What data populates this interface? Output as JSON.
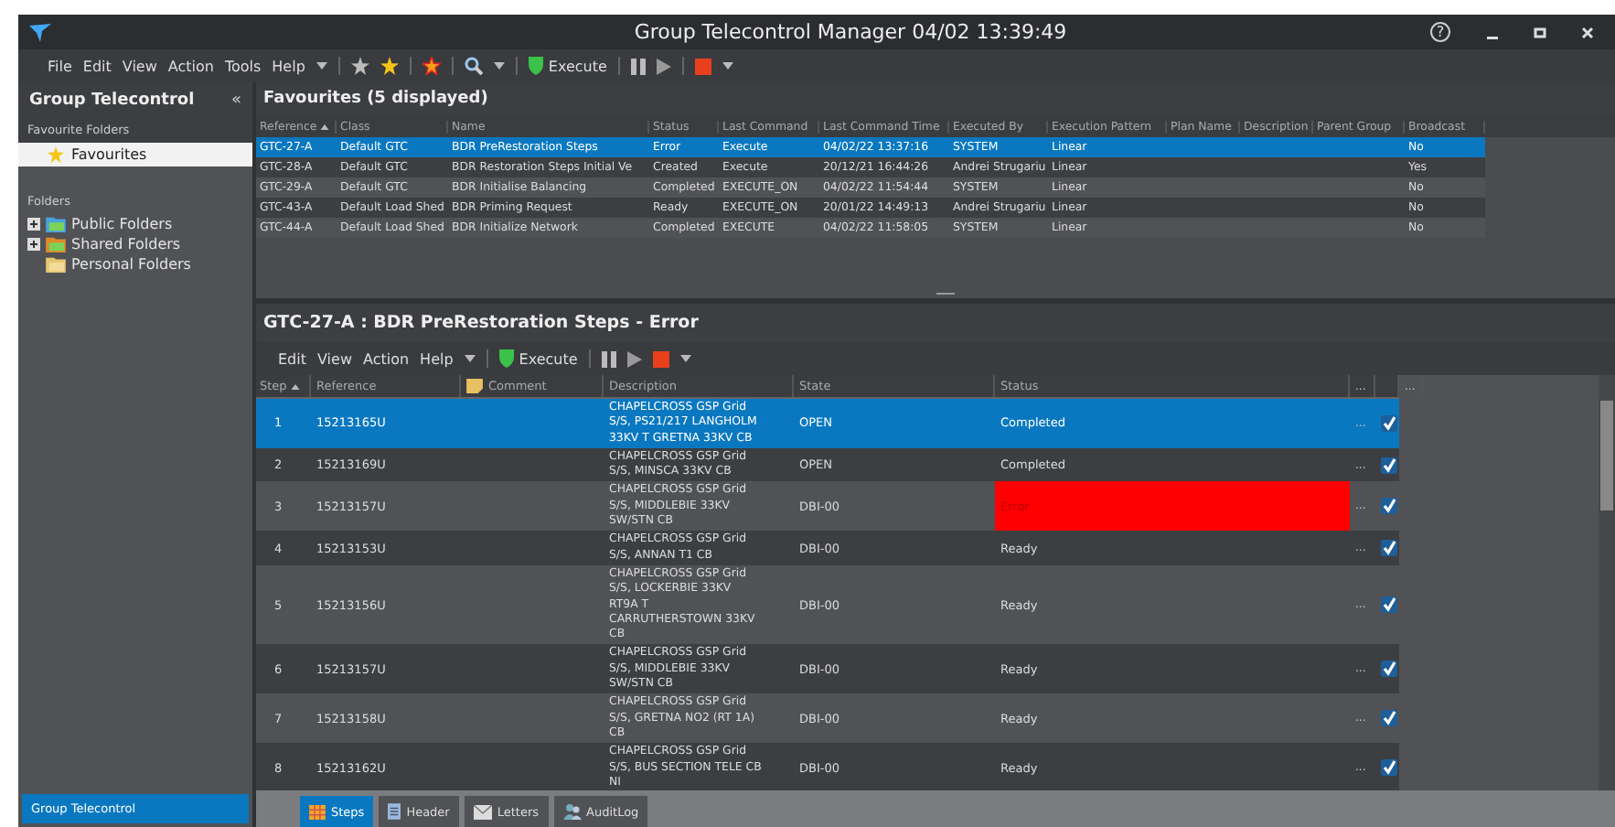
{
  "window": {
    "title": "Group Telecontrol Manager 04/02 13:39:49",
    "help": "?"
  },
  "menu": [
    "File",
    "Edit",
    "View",
    "Action",
    "Tools",
    "Help"
  ],
  "toolbar": {
    "execute": "Execute"
  },
  "sidebar": {
    "title": "Group Telecontrol",
    "collapse": "«",
    "favourite_folders_label": "Favourite Folders",
    "favourites": [
      {
        "label": "Favourites",
        "selected": true
      }
    ],
    "folders_label": "Folders",
    "folders": [
      {
        "label": "Public Folders",
        "expanded": false
      },
      {
        "label": "Shared Folders",
        "expanded": false
      },
      {
        "label": "Personal Folders"
      }
    ],
    "footer": "Group Telecontrol"
  },
  "favourites": {
    "title": "Favourites (5 displayed)",
    "columns": [
      {
        "label": "Reference",
        "sorted": true
      },
      {
        "label": "Class"
      },
      {
        "label": "Name"
      },
      {
        "label": "Status"
      },
      {
        "label": "Last Command"
      },
      {
        "label": "Last Command Time"
      },
      {
        "label": "Executed By"
      },
      {
        "label": "Execution Pattern"
      },
      {
        "label": "Plan Name"
      },
      {
        "label": "Description"
      },
      {
        "label": "Parent Group"
      },
      {
        "label": "Broadcast"
      }
    ],
    "rows": [
      {
        "selected": true,
        "cells": [
          "GTC-27-A",
          "Default GTC",
          "BDR PreRestoration Steps",
          "Error",
          "Execute",
          "04/02/22 13:37:16",
          "SYSTEM",
          "Linear",
          "",
          "",
          "",
          "No"
        ]
      },
      {
        "selected": false,
        "cells": [
          "GTC-28-A",
          "Default GTC",
          "BDR Restoration Steps Initial Ve",
          "Created",
          "Execute",
          "20/12/21 16:44:26",
          "Andrei Strugariu",
          "Linear",
          "",
          "",
          "",
          "Yes"
        ]
      },
      {
        "selected": false,
        "cells": [
          "GTC-29-A",
          "Default GTC",
          "BDR Initialise Balancing",
          "Completed",
          "EXECUTE_ON",
          "04/02/22 11:54:44",
          "SYSTEM",
          "Linear",
          "",
          "",
          "",
          "No"
        ]
      },
      {
        "selected": false,
        "cells": [
          "GTC-43-A",
          "Default Load Shed",
          "BDR Priming Request",
          "Ready",
          "EXECUTE_ON",
          "20/01/22 14:49:13",
          "Andrei Strugariu",
          "Linear",
          "",
          "",
          "",
          "No"
        ]
      },
      {
        "selected": false,
        "cells": [
          "GTC-44-A",
          "Default Load Shed",
          "BDR Initialize Network",
          "Completed",
          "EXECUTE",
          "04/02/22 11:58:05",
          "SYSTEM",
          "Linear",
          "",
          "",
          "",
          "No"
        ]
      }
    ]
  },
  "steps_panel": {
    "title": "GTC-27-A : BDR PreRestoration Steps - Error",
    "menu": [
      "Edit",
      "View",
      "Action",
      "Help"
    ],
    "execute": "Execute",
    "columns": [
      {
        "label": "Step",
        "sorted": true
      },
      {
        "label": "Reference"
      },
      {
        "label": "Comment"
      },
      {
        "label": "Description"
      },
      {
        "label": "State"
      },
      {
        "label": "Status"
      }
    ],
    "extra_headers": [
      "...",
      "..."
    ],
    "rows": [
      {
        "step": "1",
        "reference": "15213165U",
        "description": "CHAPELCROSS GSP Grid\nS/S, PS21/217 LANGHOLM\n33KV T GRETNA 33KV CB",
        "state": "OPEN",
        "status": "Completed",
        "error": false,
        "more": "...",
        "checked": true,
        "selected": true
      },
      {
        "step": "2",
        "reference": "15213169U",
        "description": "CHAPELCROSS GSP Grid\nS/S, MINSCA 33KV CB",
        "state": "OPEN",
        "status": "Completed",
        "error": false,
        "more": "...",
        "checked": true,
        "selected": false
      },
      {
        "step": "3",
        "reference": "15213157U",
        "description": "CHAPELCROSS GSP Grid\nS/S, MIDDLEBIE 33KV\nSW/STN CB",
        "state": "DBI-00",
        "status": "Error",
        "error": true,
        "more": "...",
        "checked": true,
        "selected": false
      },
      {
        "step": "4",
        "reference": "15213153U",
        "description": "CHAPELCROSS GSP Grid\nS/S, ANNAN T1 CB",
        "state": "DBI-00",
        "status": "Ready",
        "error": false,
        "more": "...",
        "checked": true,
        "selected": false
      },
      {
        "step": "5",
        "reference": "15213156U",
        "description": "CHAPELCROSS GSP Grid\nS/S, LOCKERBIE 33KV\nRT9A T\nCARRUTHERSTOWN 33KV\nCB",
        "state": "DBI-00",
        "status": "Ready",
        "error": false,
        "more": "...",
        "checked": true,
        "selected": false
      },
      {
        "step": "6",
        "reference": "15213157U",
        "description": "CHAPELCROSS GSP Grid\nS/S, MIDDLEBIE 33KV\nSW/STN CB",
        "state": "DBI-00",
        "status": "Ready",
        "error": false,
        "more": "...",
        "checked": true,
        "selected": false
      },
      {
        "step": "7",
        "reference": "15213158U",
        "description": "CHAPELCROSS GSP Grid\nS/S, GRETNA NO2 (RT 1A)\nCB",
        "state": "DBI-00",
        "status": "Ready",
        "error": false,
        "more": "...",
        "checked": true,
        "selected": false
      },
      {
        "step": "8",
        "reference": "15213162U",
        "description": "CHAPELCROSS GSP Grid\nS/S, BUS SECTION TELE CB\nNI",
        "state": "DBI-00",
        "status": "Ready",
        "error": false,
        "more": "...",
        "checked": true,
        "selected": false
      }
    ]
  },
  "tabs": [
    {
      "label": "Steps",
      "selected": true
    },
    {
      "label": "Header",
      "selected": false
    },
    {
      "label": "Letters",
      "selected": false
    },
    {
      "label": "AuditLog",
      "selected": false
    }
  ]
}
